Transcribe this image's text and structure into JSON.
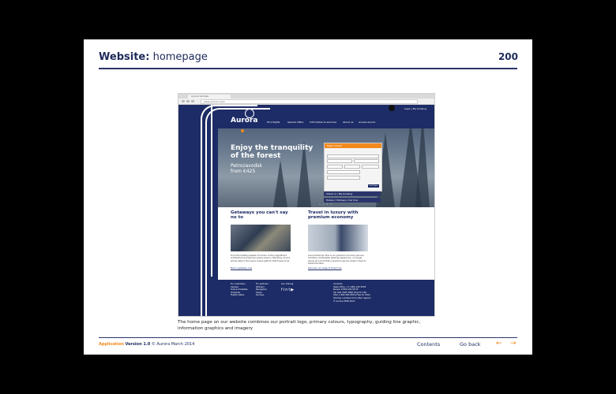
{
  "header": {
    "section_bold": "Website:",
    "section_rest": "homepage",
    "page_number": "200"
  },
  "browser": {
    "tab_label": "Aurora Airlines",
    "address": "www.aurora.ru/en"
  },
  "site": {
    "logo_text": "Aurora",
    "login_text": "Login | My booking",
    "nav": [
      "Find flights",
      "Special offers",
      "Information & services",
      "About us",
      "Access Aurora"
    ],
    "hero_title": "Enjoy the tranquility of the forest",
    "hero_sub_1": "Petrozavodsk",
    "hero_sub_2": "from €425",
    "widget_title": "Flight search",
    "widget_button": "Find flights",
    "bar_1": "Check in / My booking",
    "bar_2": "Hotels / Holidays / Car hire",
    "col1_heading": "Getaways you can't say no to",
    "col1_text": "From the bustling streets of London to the magnificent architecture and glorious green parks in Hamburg, Aurora will be able to find some unique gifts for that travel mind.",
    "col1_link": "Book a getaway now",
    "col2_heading": "Travel in luxury with premium economy",
    "col2_text": "Aurora Premium Plus is our premium economy service. Combine comfortable relaxing experience, no longer queue and proof that a premium service doesn't have to break the bank.",
    "col2_link": "Discover our range of travel now",
    "footer": {
      "col1_title": "For customers",
      "col1_items": [
        "Careers",
        "Online timetable",
        "Schedule",
        "Flights status"
      ],
      "col2_title": "For partners",
      "col2_items": [
        "Partners",
        "Navigation",
        "Cargo",
        "Surveys"
      ],
      "col3_title": "Our sharing",
      "col4_title": "Contacts",
      "col4_items": [
        "Head office: +7 (495) 223 5555",
        "Russia: 8 800 444 55 55",
        "UK: 020 7025 3800 (Free for UK)",
        "USA: 1 800 500 9554 (Free for USA)",
        "Toll-free numbers from other regions",
        "© Aurora 2008–2013"
      ]
    }
  },
  "caption": "The home page on our website combines our portrait logo, primary colours, typography, guiding line graphic, information graphics and imagery",
  "footer": {
    "application": "Application",
    "version": "Version 1.0",
    "copyright": "© Aurora  March 2014",
    "contents": "Contents",
    "go_back": "Go back",
    "prev_arrow": "←",
    "next_arrow": "→"
  },
  "colors": {
    "navy": "#1d2c66",
    "orange": "#f08a1c"
  }
}
